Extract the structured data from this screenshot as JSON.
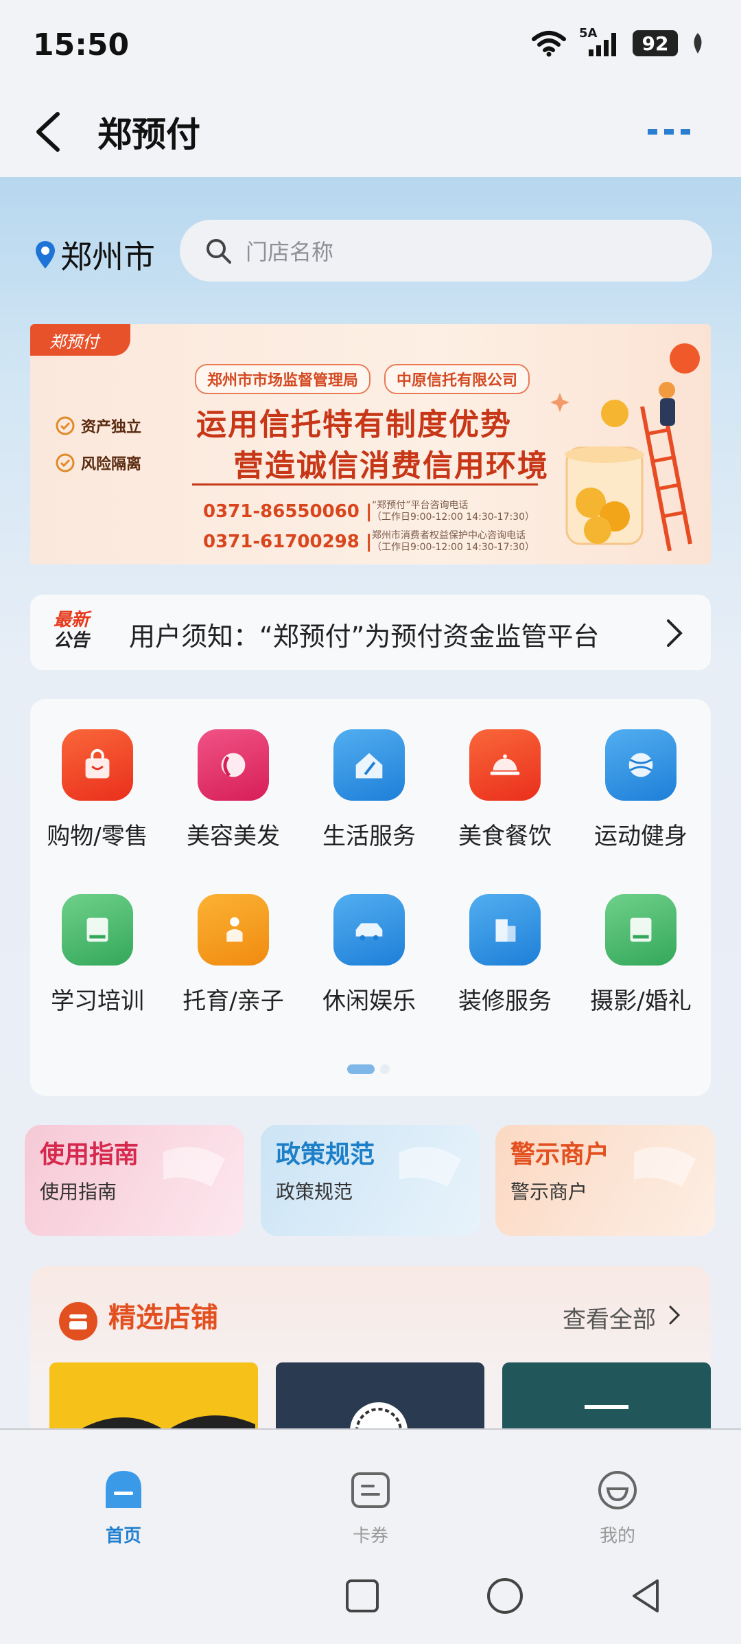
{
  "status_bar": {
    "time": "15:50",
    "network": "5A",
    "battery": "92"
  },
  "header": {
    "title": "郑预付"
  },
  "location": {
    "city": "郑州市"
  },
  "search": {
    "placeholder": "门店名称"
  },
  "banner": {
    "tag": "郑预付",
    "org_1": "郑州市市场监督管理局",
    "org_2": "中原信托有限公司",
    "check_1": "资产独立",
    "check_2": "风险隔离",
    "line_1": "运用信托特有制度优势",
    "line_2": "营造诚信消费信用环境",
    "phone_1": "0371-86550060 |",
    "phone_2": "0371-61700298 |",
    "note_1": "“郑预付”平台咨询电话\n（工作日9:00-12:00 14:30-17:30）",
    "note_2": "郑州市消费者权益保护中心咨询电话\n（工作日9:00-12:00 14:30-17:30）",
    "colors": {
      "accent": "#c73616",
      "tag": "#e8522b"
    }
  },
  "notice": {
    "badge_line1": "最新",
    "badge_line2": "公告",
    "text": "用户须知：“郑预付”为预付资金监管平台"
  },
  "categories": [
    {
      "label": "购物/零售",
      "icon": "shopping-bag-icon",
      "color": "#f04a2a"
    },
    {
      "label": "美容美发",
      "icon": "beauty-face-icon",
      "color": "#e8336a"
    },
    {
      "label": "生活服务",
      "icon": "home-broom-icon",
      "color": "#2e8fe0"
    },
    {
      "label": "美食餐饮",
      "icon": "food-cloche-icon",
      "color": "#ee4b27"
    },
    {
      "label": "运动健身",
      "icon": "ball-icon",
      "color": "#2e8fe0"
    },
    {
      "label": "学习培训",
      "icon": "book-icon",
      "color": "#46b865"
    },
    {
      "label": "托育/亲子",
      "icon": "parent-child-icon",
      "color": "#f59a1c"
    },
    {
      "label": "休闲娱乐",
      "icon": "car-icon",
      "color": "#2e8fe0"
    },
    {
      "label": "装修服务",
      "icon": "building-icon",
      "color": "#2e8fe0"
    },
    {
      "label": "摄影/婚礼",
      "icon": "book-icon",
      "color": "#46b865"
    }
  ],
  "pager": {
    "current": 1,
    "total": 2
  },
  "guides": [
    {
      "title": "使用指南",
      "subtitle": "使用指南"
    },
    {
      "title": "政策规范",
      "subtitle": "政策规范"
    },
    {
      "title": "警示商户",
      "subtitle": "警示商户"
    }
  ],
  "featured": {
    "title": "精选店铺",
    "view_all": "查看全部"
  },
  "tabs": [
    {
      "label": "首页",
      "icon": "home-icon",
      "active": true
    },
    {
      "label": "卡券",
      "icon": "card-voucher-icon",
      "active": false
    },
    {
      "label": "我的",
      "icon": "profile-face-icon",
      "active": false
    }
  ]
}
